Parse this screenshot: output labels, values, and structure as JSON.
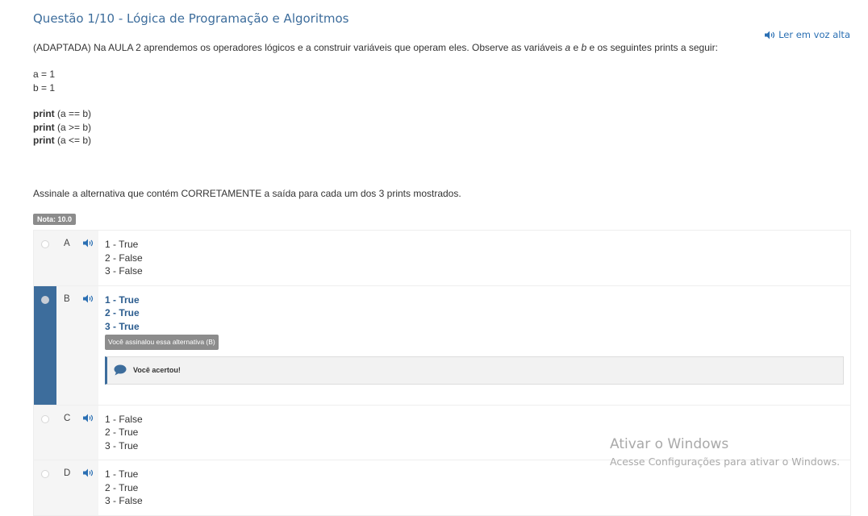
{
  "question": {
    "title": "Questão 1/10 - Lógica de Programação e Algoritmos",
    "read_aloud": "Ler em voz alta",
    "intro_before": "(ADAPTADA) Na AULA 2 aprendemos os operadores lógicos e a construir variáveis que operam eles. Observe as variáveis ",
    "var_a": "a",
    "intro_mid": " e ",
    "var_b": "b",
    "intro_after": " e os seguintes prints a seguir:",
    "variables": [
      "a = 1",
      "b = 1"
    ],
    "prints": [
      {
        "keyword": "print",
        "expr": " (a == b)"
      },
      {
        "keyword": "print",
        "expr": " (a >= b)"
      },
      {
        "keyword": "print",
        "expr": " (a <= b)"
      }
    ],
    "instruction": "Assinale a alternativa que contém CORRETAMENTE a saída para cada um dos 3 prints mostrados.",
    "grade": "Nota: 10.0"
  },
  "alternatives": [
    {
      "letter": "A",
      "lines": [
        "1 - True",
        "2 - False",
        "3 - False"
      ]
    },
    {
      "letter": "B",
      "lines": [
        "1 - True",
        "2 - True",
        "3 - True"
      ],
      "selected_badge": "Você assinalou essa alternativa (B)",
      "feedback": "Você acertou!"
    },
    {
      "letter": "C",
      "lines": [
        "1 - False",
        "2 - True",
        "3 - True"
      ]
    },
    {
      "letter": "D",
      "lines": [
        "1 - True",
        "2 - True",
        "3 - False"
      ]
    }
  ],
  "watermark": {
    "title": "Ativar o Windows",
    "subtitle": "Acesse Configurações para ativar o Windows."
  },
  "colors": {
    "accent": "#3d6d9c",
    "link": "#2a6fb3"
  }
}
